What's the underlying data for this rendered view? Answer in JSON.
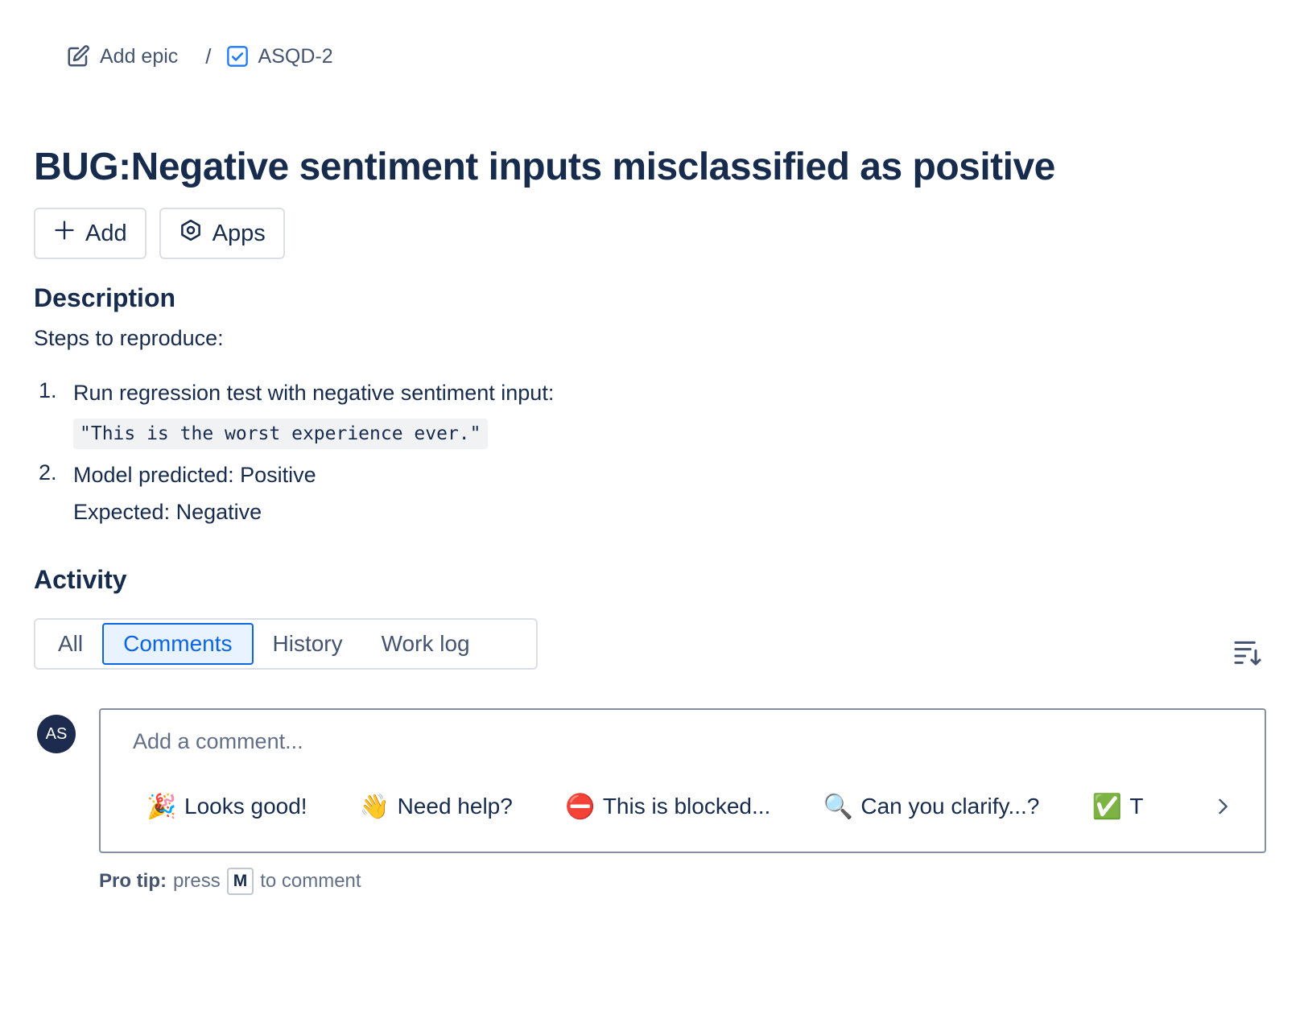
{
  "breadcrumb": {
    "epic_label": "Add epic",
    "separator": "/",
    "issue_key": "ASQD-2"
  },
  "issue": {
    "title": "BUG:Negative sentiment inputs misclassified as positive"
  },
  "actions": {
    "add_label": "Add",
    "apps_label": "Apps"
  },
  "description": {
    "heading": "Description",
    "intro": "Steps to reproduce:",
    "steps": [
      {
        "number": "1.",
        "text": "Run regression test with negative sentiment input:",
        "code": "\"This is the worst experience ever.\""
      },
      {
        "number": "2.",
        "text": "Model predicted: Positive",
        "extra": "Expected: Negative"
      }
    ]
  },
  "activity": {
    "heading": "Activity",
    "tabs": [
      {
        "label": "All",
        "selected": false
      },
      {
        "label": "Comments",
        "selected": true
      },
      {
        "label": "History",
        "selected": false
      },
      {
        "label": "Work log",
        "selected": false
      }
    ],
    "sort_icon": "sort-icon"
  },
  "comment": {
    "avatar_initials": "AS",
    "placeholder": "Add a comment...",
    "quick_replies": [
      {
        "emoji": "🎉",
        "label": "Looks good!"
      },
      {
        "emoji": "👋",
        "label": "Need help?"
      },
      {
        "emoji": "⛔",
        "label": "This is blocked..."
      },
      {
        "emoji": "🔍",
        "label": "Can you clarify...?"
      },
      {
        "emoji": "✅",
        "label": "T"
      }
    ],
    "pro_tip_label": "Pro tip:",
    "pro_tip_press": "press",
    "pro_tip_key": "M",
    "pro_tip_suffix": "to comment"
  },
  "colors": {
    "accent": "#0c66e4",
    "text": "#172b4d",
    "subtle_text": "#44546f",
    "avatar_bg": "#1d2b4f"
  }
}
